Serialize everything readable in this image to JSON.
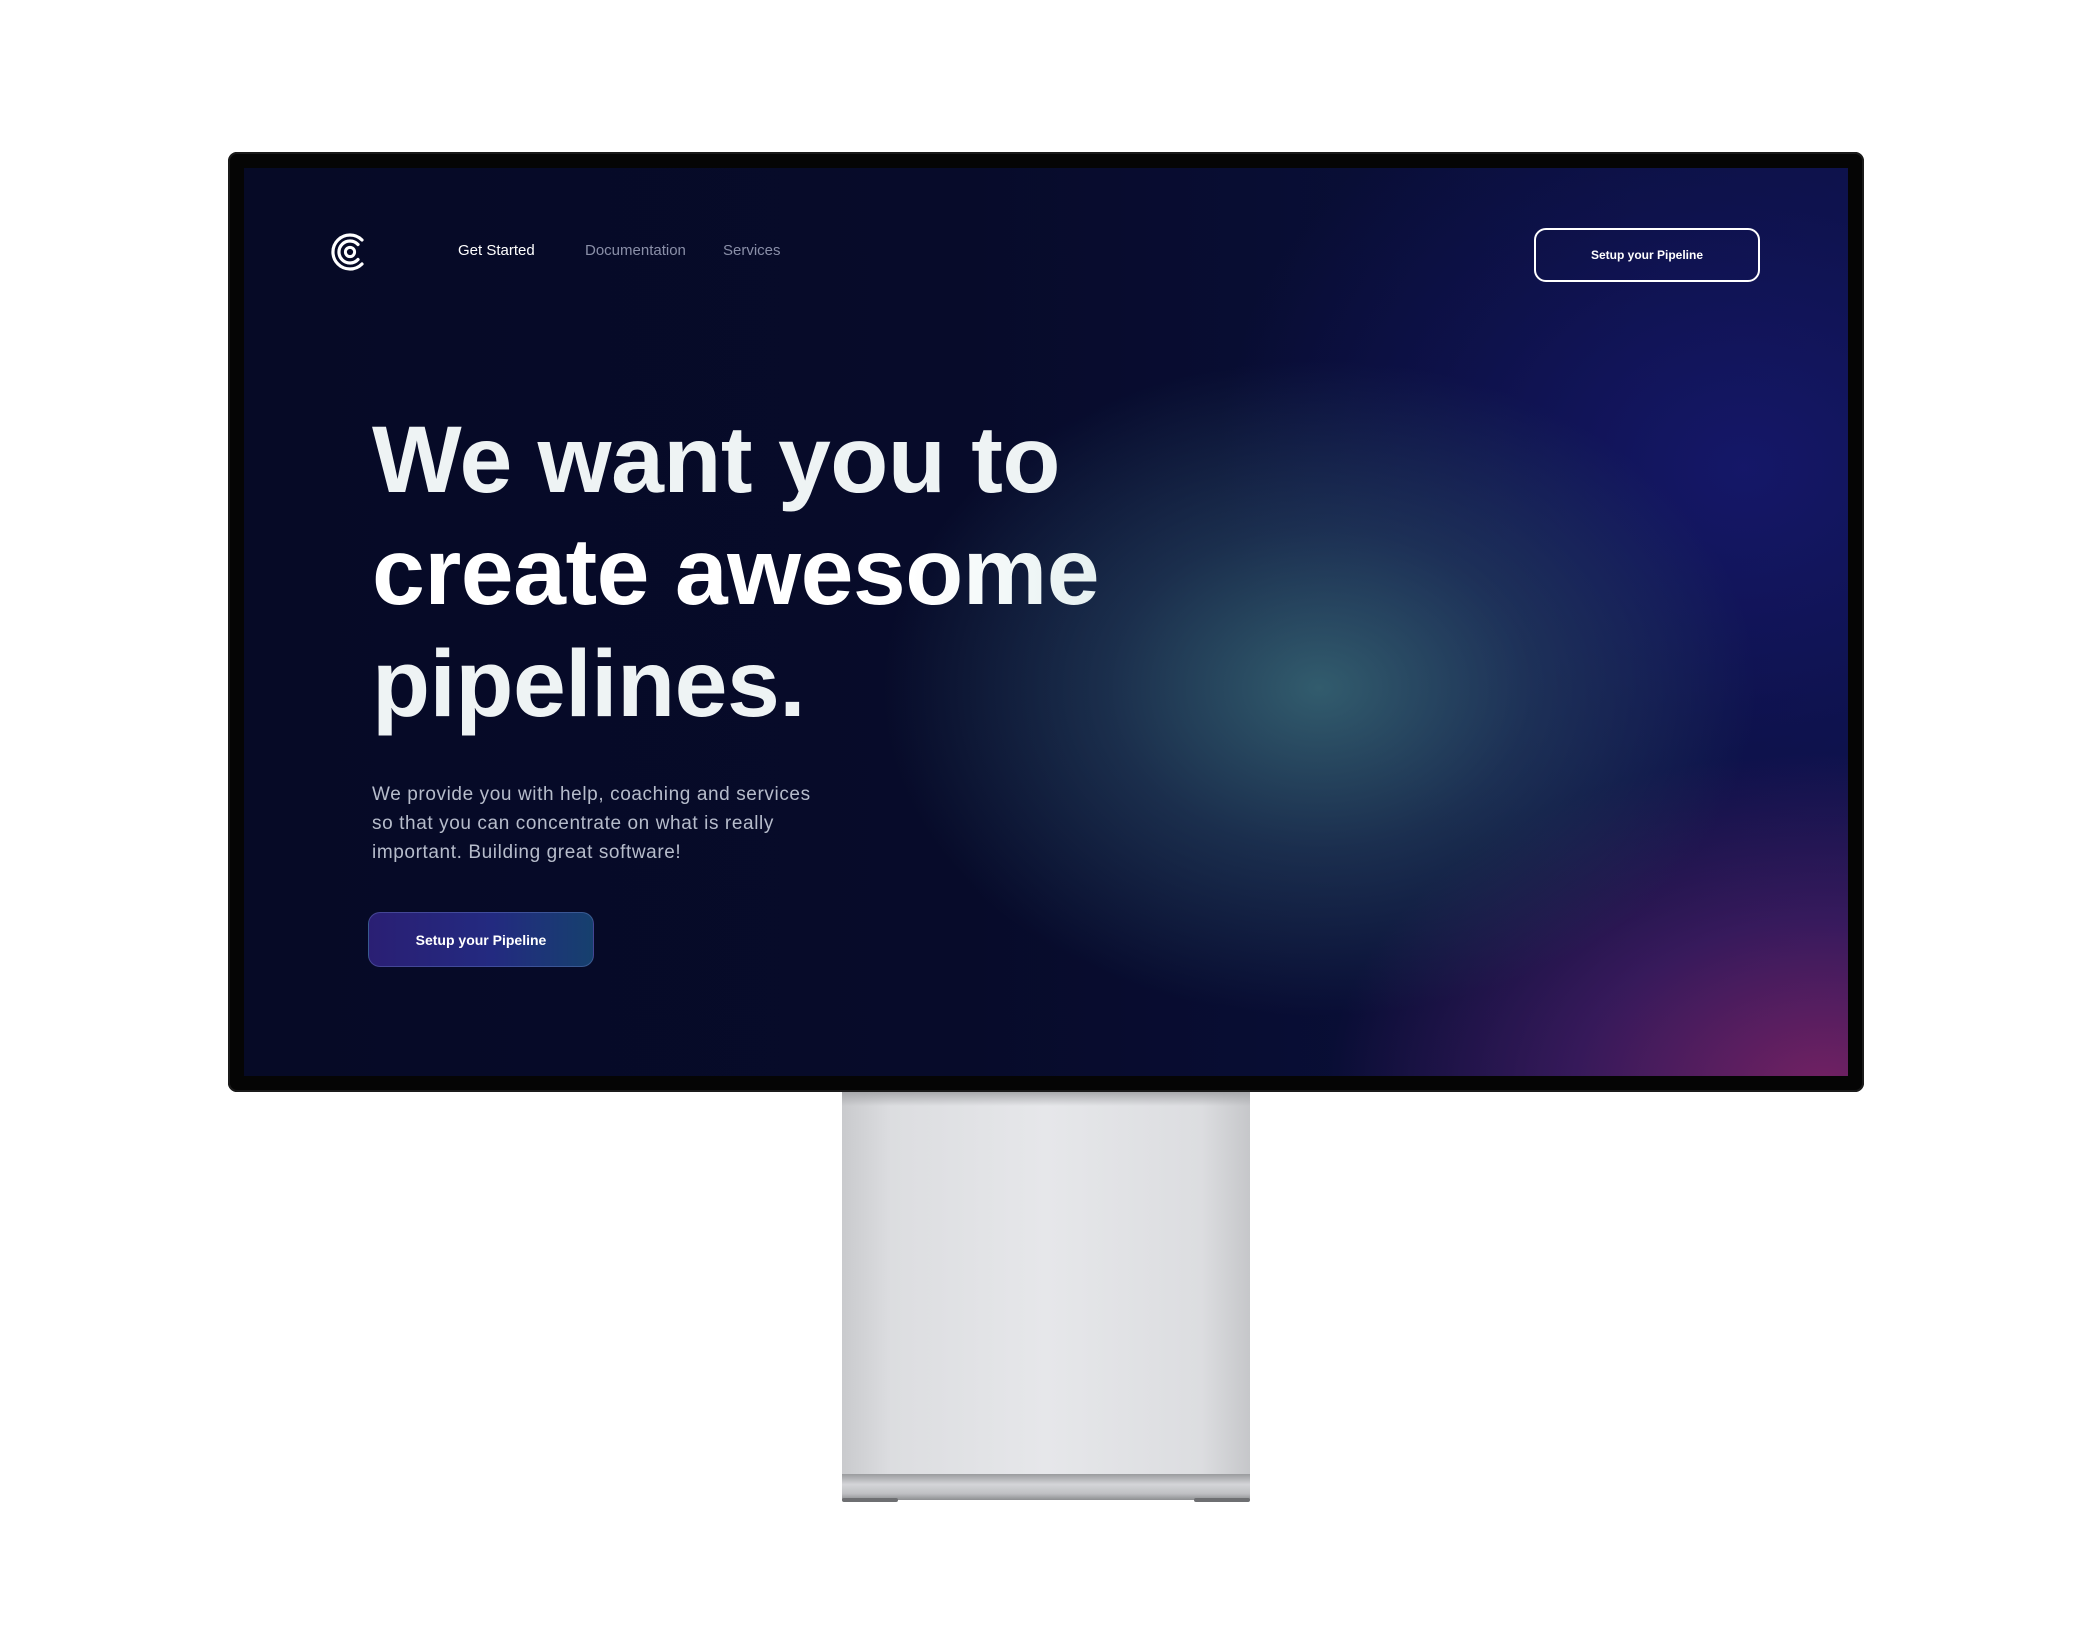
{
  "header": {
    "logo_icon": "concentric-c-logo-icon",
    "nav": [
      {
        "label": "Get Started",
        "active": true
      },
      {
        "label": "Documentation",
        "active": false
      },
      {
        "label": "Services",
        "active": false
      }
    ],
    "cta_label": "Setup your Pipeline"
  },
  "hero": {
    "title_lines": [
      "We want you to",
      "create awesome",
      "pipelines."
    ],
    "subtitle_lines": [
      "We provide you with help, coaching and services",
      "so that you can concentrate on what is really",
      "important. Building great software!"
    ],
    "cta_label": "Setup your Pipeline"
  },
  "colors": {
    "background": "#070a26",
    "glow_teal": "#346070",
    "glow_magenta": "#782264",
    "text_primary": "#ffffff",
    "text_muted": "#8a8fa8",
    "cta_gradient_start": "#2a1f74",
    "cta_gradient_end": "#16406e"
  }
}
